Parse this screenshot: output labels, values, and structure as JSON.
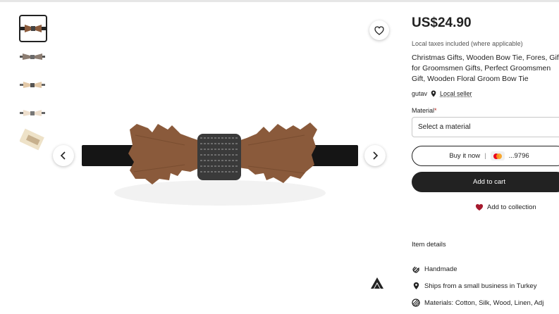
{
  "gallery": {
    "thumbnails": [
      {
        "name": "bow-tie-wood-walnut",
        "selected": true
      },
      {
        "name": "bow-tie-wood-grey"
      },
      {
        "name": "bow-tie-wood-light"
      },
      {
        "name": "bow-tie-wood-light-2"
      },
      {
        "name": "bow-tie-packaging"
      }
    ],
    "favorite_icon": "heart-outline-icon",
    "prev_icon": "chevron-left-icon",
    "next_icon": "chevron-right-icon"
  },
  "product": {
    "price": "US$24.90",
    "tax_note": "Local taxes included (where applicable)",
    "title": "Christmas Gifts, Wooden Bow Tie, Fores, Gift for Groomsmen Gifts, Perfect Groomsmen Gift, Wooden Floral Groom Bow Tie",
    "shop_name": "gutav",
    "local_seller": "Local seller"
  },
  "options": {
    "material_label": "Material",
    "required_mark": "*",
    "select_placeholder": "Select a material"
  },
  "actions": {
    "buy_now": "Buy it now",
    "card_last4": "...9796",
    "add_to_cart": "Add to cart",
    "add_to_collection": "Add to collection"
  },
  "details": {
    "header": "Item details",
    "items": [
      {
        "icon": "hand-icon",
        "text": "Handmade"
      },
      {
        "icon": "location-pin-icon",
        "text": "Ships from a small business in Turkey"
      },
      {
        "icon": "materials-icon",
        "text": "Materials: Cotton, Silk, Wood, Linen, Adj"
      }
    ]
  },
  "colors": {
    "accent_dark": "#222222",
    "heart_red": "#a61a2e",
    "required_red": "#b3261e"
  }
}
